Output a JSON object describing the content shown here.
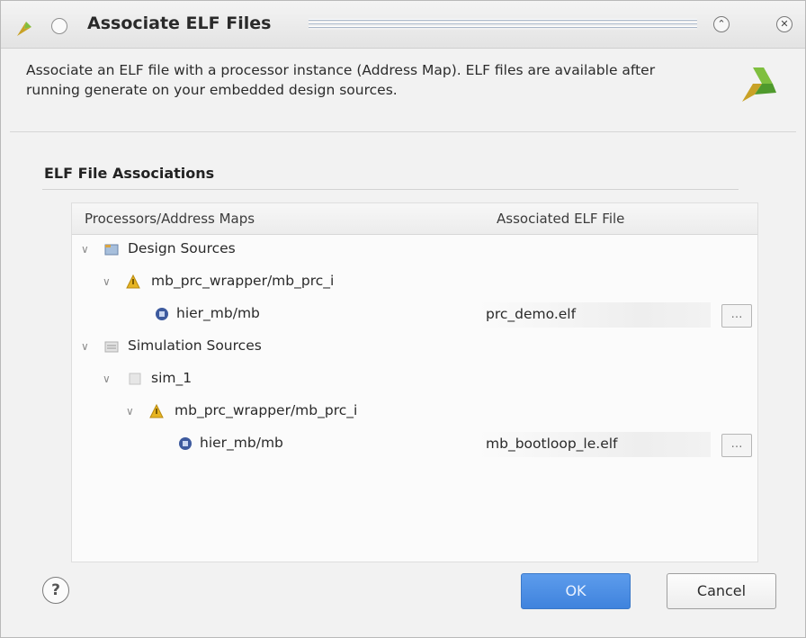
{
  "window": {
    "title": "Associate ELF Files",
    "minimize_glyph": "⌃",
    "close_glyph": "✕"
  },
  "description": "Associate an ELF file with a processor instance (Address Map). ELF files are available after running generate on your embedded design sources.",
  "section": {
    "title": "ELF File Associations"
  },
  "table": {
    "columns": [
      "Processors/Address Maps",
      "Associated ELF File"
    ],
    "rows": [
      {
        "label": "Design Sources",
        "icon": "design-sources-icon",
        "elf": ""
      },
      {
        "label": "mb_prc_wrapper/mb_prc_i",
        "icon": "block-design-warning-icon",
        "elf": ""
      },
      {
        "label": "hier_mb/mb",
        "icon": "processor-icon",
        "elf": "prc_demo.elf"
      },
      {
        "label": "Simulation Sources",
        "icon": "simulation-sources-icon",
        "elf": ""
      },
      {
        "label": "sim_1",
        "icon": "fileset-icon",
        "elf": ""
      },
      {
        "label": "mb_prc_wrapper/mb_prc_i",
        "icon": "block-design-warning-icon",
        "elf": ""
      },
      {
        "label": "hier_mb/mb",
        "icon": "processor-icon",
        "elf": "mb_bootloop_le.elf"
      }
    ],
    "browse_glyph": "…"
  },
  "footer": {
    "help_label": "?",
    "ok_label": "OK",
    "cancel_label": "Cancel"
  },
  "colors": {
    "ok_button": "#4a8fe3",
    "warning_icon": "#e6b422",
    "processor_icon": "#3d5a9e"
  }
}
